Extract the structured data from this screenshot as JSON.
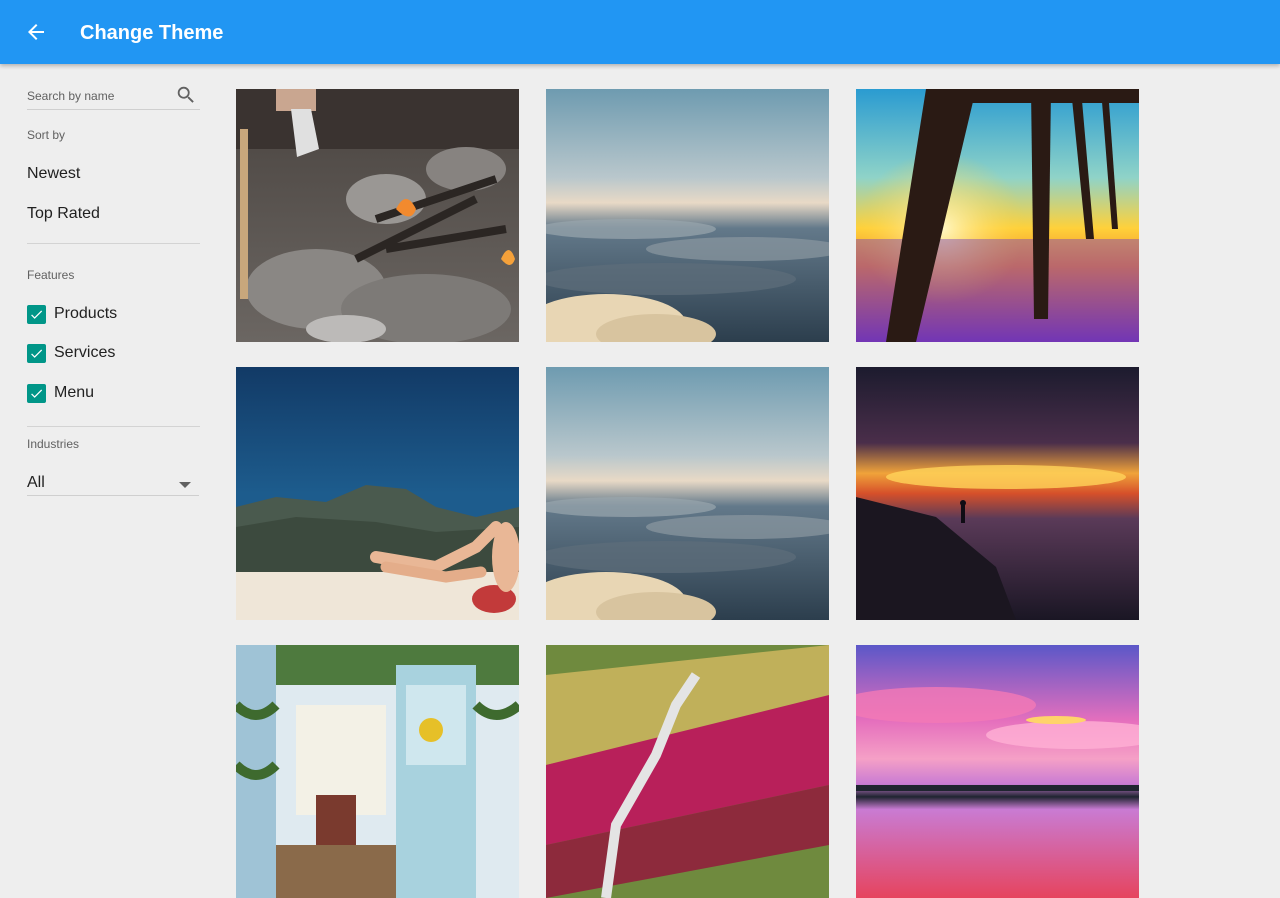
{
  "appbar": {
    "title": "Change Theme",
    "color": "#2196f3",
    "back_icon": "arrow-back-icon"
  },
  "sidebar": {
    "search": {
      "placeholder": "Search by name",
      "value": "",
      "icon": "search-icon"
    },
    "sort": {
      "label": "Sort by",
      "options": [
        "Newest",
        "Top Rated"
      ]
    },
    "features": {
      "label": "Features",
      "items": [
        {
          "label": "Products",
          "checked": true
        },
        {
          "label": "Services",
          "checked": true
        },
        {
          "label": "Menu",
          "checked": true
        }
      ],
      "check_color": "#009688"
    },
    "industries": {
      "label": "Industries",
      "selected": "All",
      "icon": "arrow-drop-down-icon"
    }
  },
  "gallery": {
    "themes": [
      {
        "subject": "campfire on rocks"
      },
      {
        "subject": "sea of clouds at sunrise"
      },
      {
        "subject": "pier at sunset"
      },
      {
        "subject": "legs over mountain beach"
      },
      {
        "subject": "sea of clouds at sunrise"
      },
      {
        "subject": "figure on beach at sunset"
      },
      {
        "subject": "greenhouse doorway"
      },
      {
        "subject": "flowered hillside path"
      },
      {
        "subject": "pink sunset over lake"
      }
    ]
  }
}
